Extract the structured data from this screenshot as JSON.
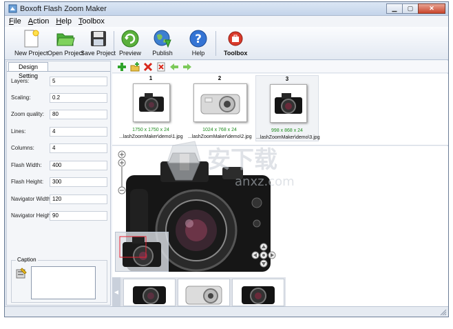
{
  "window": {
    "title": "Boxoft Flash Zoom Maker"
  },
  "titlebar_buttons": {
    "minimize": "▁",
    "maximize": "▢",
    "close": "✕"
  },
  "menu": [
    {
      "prefix": "",
      "underlined": "F",
      "rest": "ile"
    },
    {
      "prefix": "",
      "underlined": "A",
      "rest": "ction"
    },
    {
      "prefix": "",
      "underlined": "H",
      "rest": "elp"
    },
    {
      "prefix": "",
      "underlined": "T",
      "rest": "oolbox"
    }
  ],
  "toolbar": {
    "new_project": "New Project",
    "open_project": "Open Project",
    "save_project": "Save Project",
    "preview": "Preview",
    "publish": "Publish",
    "help": "Help",
    "toolbox": "Toolbox"
  },
  "design_tab": "Design Setting",
  "settings": [
    {
      "label": "Layers:",
      "value": "5"
    },
    {
      "label": "Scaling:",
      "value": "0.2"
    },
    {
      "label": "Zoom quality:",
      "value": "80"
    },
    {
      "label": "Lines:",
      "value": "4"
    },
    {
      "label": "Columns:",
      "value": "4"
    },
    {
      "label": "Flash Width:",
      "value": "400"
    },
    {
      "label": "Flash Height:",
      "value": "300"
    },
    {
      "label": "Navigator Width:",
      "value": "120"
    },
    {
      "label": "Navigator Height:",
      "value": "90"
    }
  ],
  "caption": {
    "legend": "Caption",
    "value": ""
  },
  "thumbnails": [
    {
      "number": "1",
      "dimensions": "1750 x 1750 x 24",
      "path": "...lashZoomMaker\\demo\\1.jpg",
      "selected": false
    },
    {
      "number": "2",
      "dimensions": "1024 x 768 x 24",
      "path": "...lashZoomMaker\\demo\\2.jpg",
      "selected": false
    },
    {
      "number": "3",
      "dimensions": "998 x 868 x 24",
      "path": "...lashZoomMaker\\demo\\3.jpg",
      "selected": true
    }
  ],
  "watermark": {
    "text": "安下载",
    "sub": "anxz.com"
  },
  "colors": {
    "accent_green": "#1e8a1e",
    "title_bar": "#c4d4ea",
    "close_red": "#c9452c"
  }
}
